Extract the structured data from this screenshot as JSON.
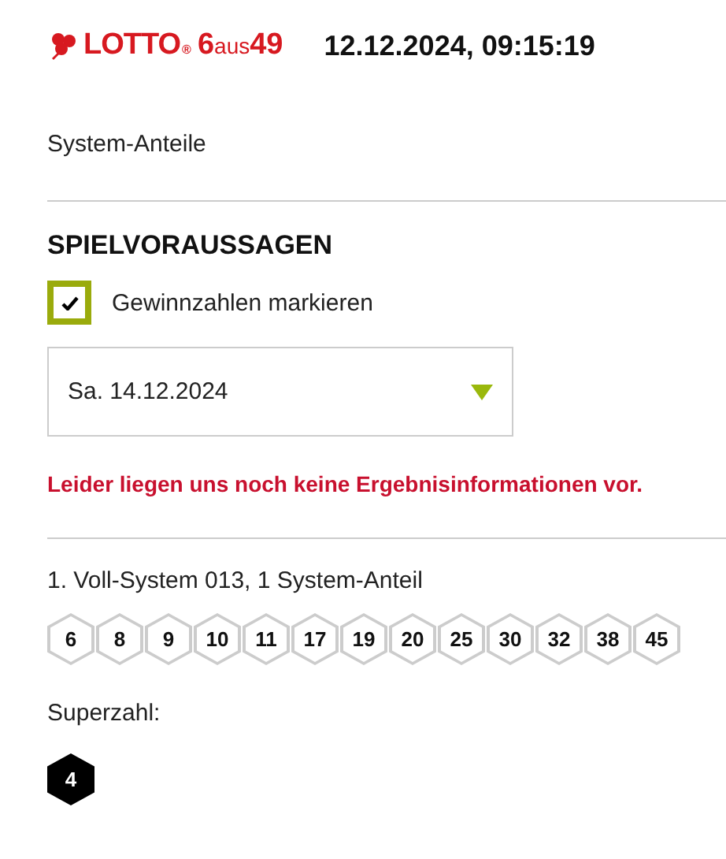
{
  "header": {
    "logo": {
      "brand": "LOTTO",
      "registered": "®",
      "six": "6",
      "aus": "aus",
      "fortynine": "49"
    },
    "datetime": "12.12.2024, 09:15:19"
  },
  "section_label": "System-Anteile",
  "predictions": {
    "title": "SPIELVORAUSSAGEN",
    "checkbox": {
      "label": "Gewinnzahlen markieren",
      "checked": true
    },
    "date_select": {
      "value": "Sa. 14.12.2024"
    },
    "error": "Leider liegen uns noch keine Ergebnisinformationen vor."
  },
  "system": {
    "title": "1. Voll-System 013, 1 System-Anteil",
    "numbers": [
      "6",
      "8",
      "9",
      "10",
      "11",
      "17",
      "19",
      "20",
      "25",
      "30",
      "32",
      "38",
      "45"
    ],
    "superzahl_label": "Superzahl:",
    "superzahl": "4"
  }
}
